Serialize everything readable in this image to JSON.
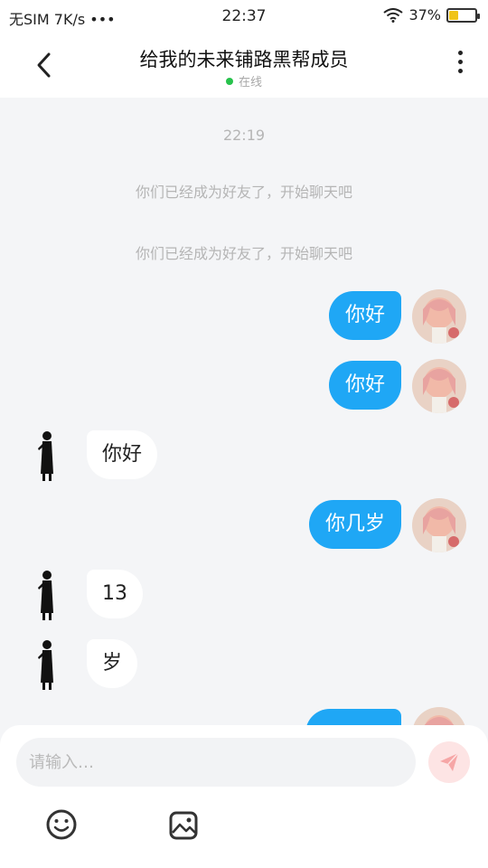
{
  "status_bar": {
    "carrier": "无SIM 7K/s •••",
    "time": "22:37",
    "battery": "37%",
    "battery_level": 0.37,
    "battery_color": "#f0c419"
  },
  "header": {
    "title": "给我的未来铺路黑帮成员",
    "status": "在线",
    "status_color": "#27c24c",
    "back_icon": "chevron-left-icon",
    "more_icon": "more-vertical-icon"
  },
  "chat": {
    "timestamp": "22:19",
    "system_messages": [
      "你们已经成为好友了，开始聊天吧",
      "你们已经成为好友了，开始聊天吧"
    ],
    "messages": [
      {
        "side": "right",
        "text": "你好"
      },
      {
        "side": "right",
        "text": "你好"
      },
      {
        "side": "left",
        "text": "你好"
      },
      {
        "side": "right",
        "text": "你几岁"
      },
      {
        "side": "left",
        "text": "13"
      },
      {
        "side": "left",
        "text": "岁"
      },
      {
        "side": "right",
        "text": ""
      }
    ],
    "bubble_color_self": "#1fa7f5"
  },
  "input": {
    "placeholder": "请输入…",
    "value": "",
    "send_icon": "send-plane-icon",
    "emoji_icon": "smile-icon",
    "image_icon": "image-icon"
  }
}
